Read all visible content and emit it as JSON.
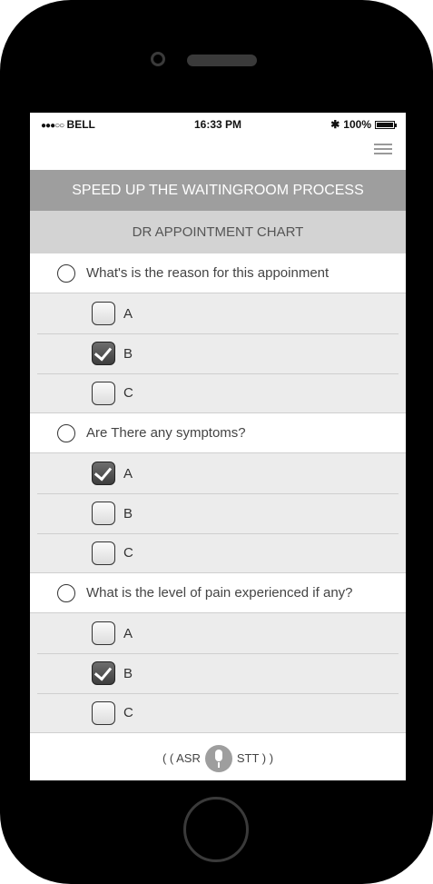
{
  "status_bar": {
    "signal": "●●●○○",
    "carrier": "BELL",
    "time": "16:33 PM",
    "bluetooth": "✱",
    "battery": "100%"
  },
  "header": {
    "banner": "SPEED UP THE WAITINGROOM PROCESS",
    "subtitle": "DR APPOINTMENT CHART"
  },
  "questions": [
    {
      "text": "What's is the reason for this appoinment",
      "options": [
        {
          "label": "A",
          "checked": false
        },
        {
          "label": "B",
          "checked": true
        },
        {
          "label": "C",
          "checked": false
        }
      ]
    },
    {
      "text": "Are There any symptoms?",
      "options": [
        {
          "label": "A",
          "checked": true
        },
        {
          "label": "B",
          "checked": false
        },
        {
          "label": "C",
          "checked": false
        }
      ]
    },
    {
      "text": "What is the level of pain experienced if any?",
      "options": [
        {
          "label": "A",
          "checked": false
        },
        {
          "label": "B",
          "checked": true
        },
        {
          "label": "C",
          "checked": false
        }
      ]
    }
  ],
  "footer": {
    "asr_label": "( ( ASR",
    "stt_label": "STT ) )"
  },
  "icons": {
    "menu": "hamburger-menu-icon",
    "mic": "microphone-icon",
    "bluetooth": "bluetooth-icon",
    "battery": "battery-icon"
  }
}
